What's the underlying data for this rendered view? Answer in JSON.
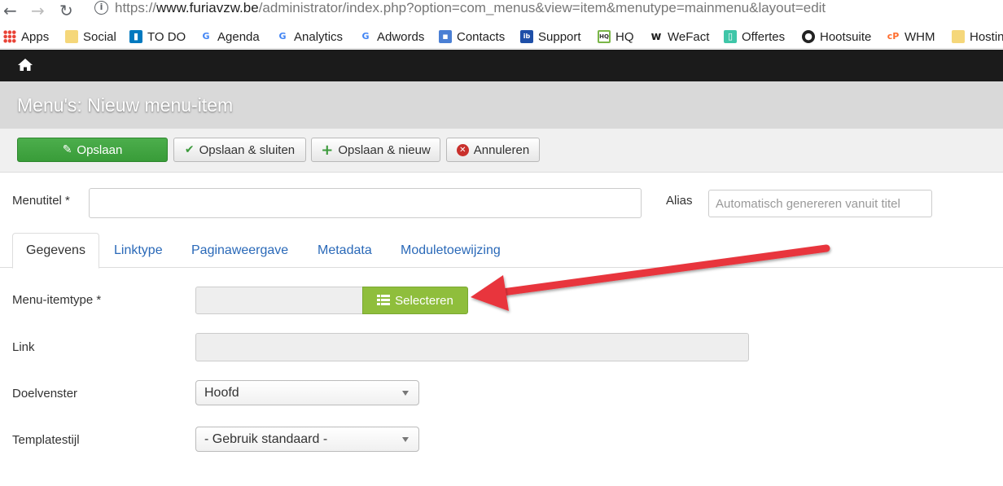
{
  "browser": {
    "url_prefix": "https://",
    "url_domain": "www.furiavzw.be",
    "url_path": "/administrator/index.php?option=com_menus&view=item&menutype=mainmenu&layout=edit",
    "bookmarks": [
      "Apps",
      "Social",
      "TO DO",
      "Agenda",
      "Analytics",
      "Adwords",
      "Contacts",
      "Support",
      "HQ",
      "WeFact",
      "Offertes",
      "Hootsuite",
      "WHM",
      "Hosting"
    ]
  },
  "page": {
    "title": "Menu's: Nieuw menu-item"
  },
  "toolbar": {
    "save": "Opslaan",
    "save_close": "Opslaan & sluiten",
    "save_new": "Opslaan & nieuw",
    "cancel": "Annuleren"
  },
  "form": {
    "menutitle_label": "Menutitel *",
    "alias_label": "Alias",
    "alias_placeholder": "Automatisch genereren vanuit titel",
    "tabs": [
      "Gegevens",
      "Linktype",
      "Paginaweergave",
      "Metadata",
      "Moduletoewijzing"
    ],
    "itemtype_label": "Menu-itemtype *",
    "select_button": "Selecteren",
    "link_label": "Link",
    "target_label": "Doelvenster",
    "target_value": "Hoofd",
    "template_label": "Templatestijl",
    "template_value": "- Gebruik standaard -"
  },
  "colors": {
    "save_green": "#3fa73f",
    "select_green": "#8fbe3c",
    "annotation_arrow": "#e8363d",
    "link_blue": "#2a69b8"
  }
}
